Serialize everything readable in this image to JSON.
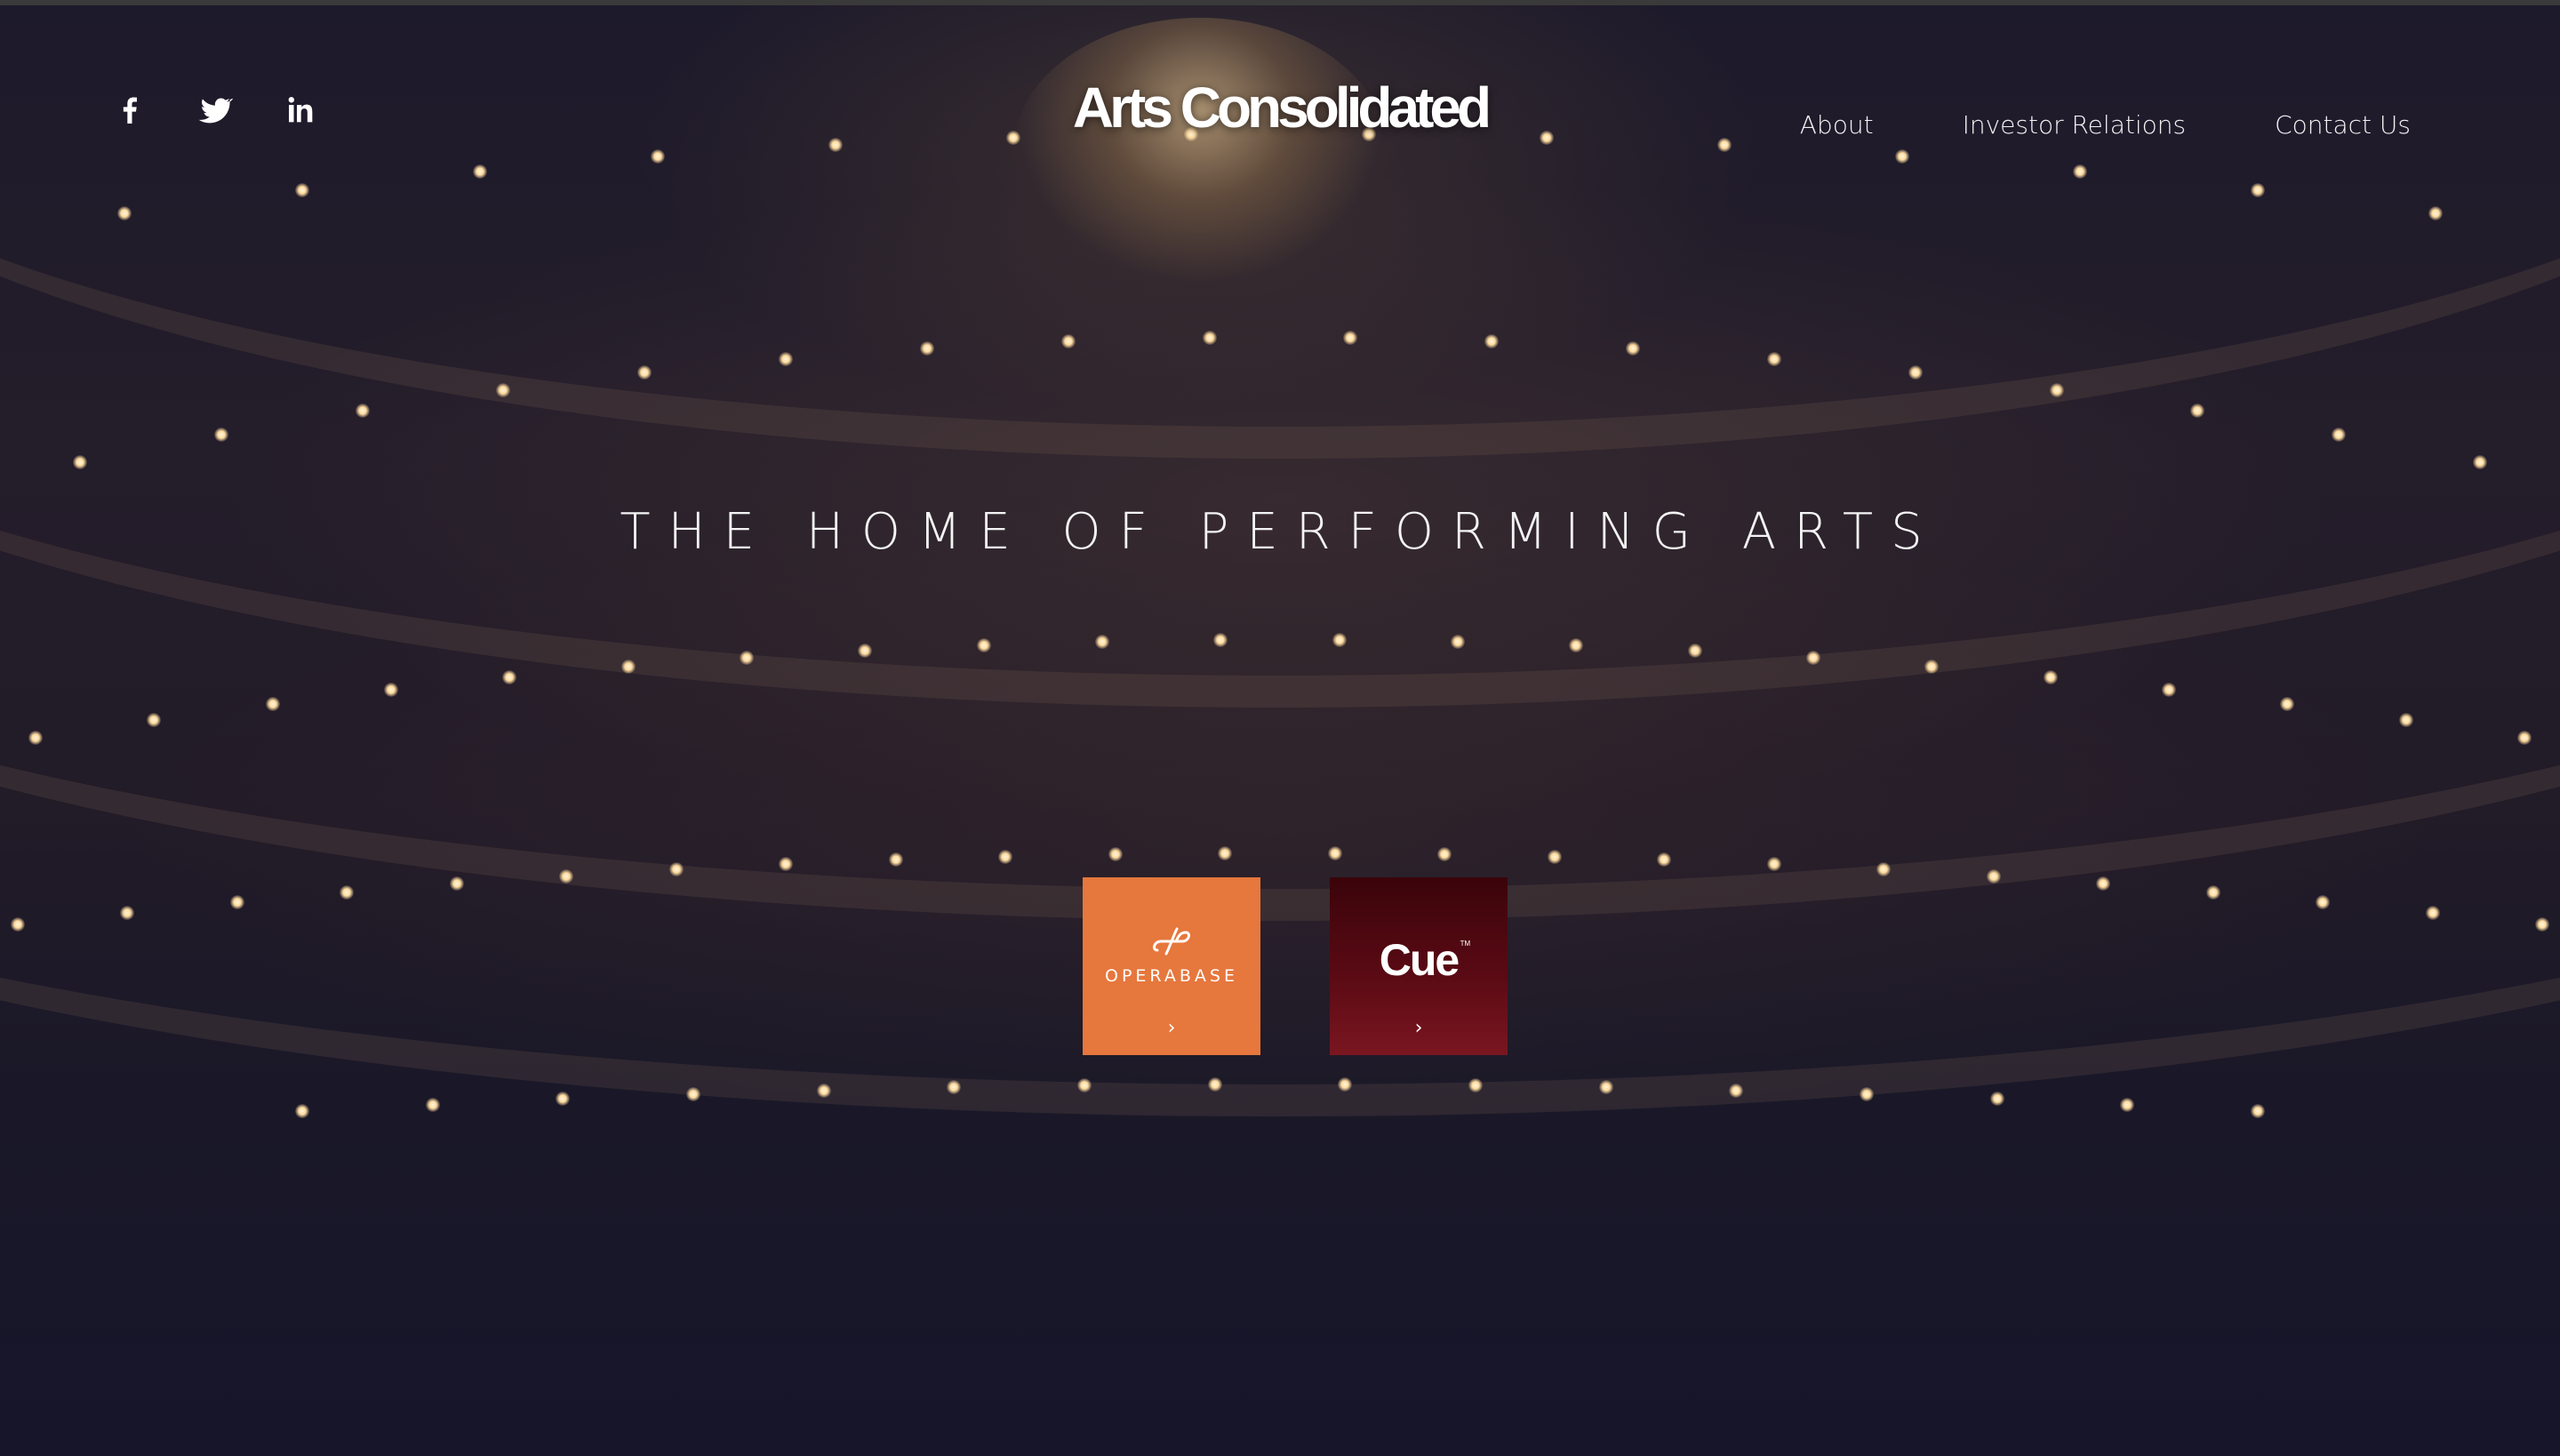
{
  "header": {
    "logo_text": "Arts Consolidated",
    "social_links": [
      {
        "name": "facebook",
        "icon": "facebook-icon"
      },
      {
        "name": "twitter",
        "icon": "twitter-icon"
      },
      {
        "name": "linkedin",
        "icon": "linkedin-icon"
      }
    ],
    "nav": [
      {
        "label": "About"
      },
      {
        "label": "Investor Relations"
      },
      {
        "label": "Contact Us"
      }
    ]
  },
  "hero": {
    "tagline": "THE HOME OF PERFORMING ARTS"
  },
  "brands": [
    {
      "name": "operabase",
      "label": "OPERABASE",
      "arrow": "›",
      "color": "#e6773d"
    },
    {
      "name": "cue",
      "label": "Cue",
      "trademark": "TM",
      "arrow": "›",
      "color": "#5a0a14"
    }
  ],
  "colors": {
    "background": "#16142a",
    "operabase_orange": "#e6773d",
    "cue_crimson": "#5a0a14"
  }
}
